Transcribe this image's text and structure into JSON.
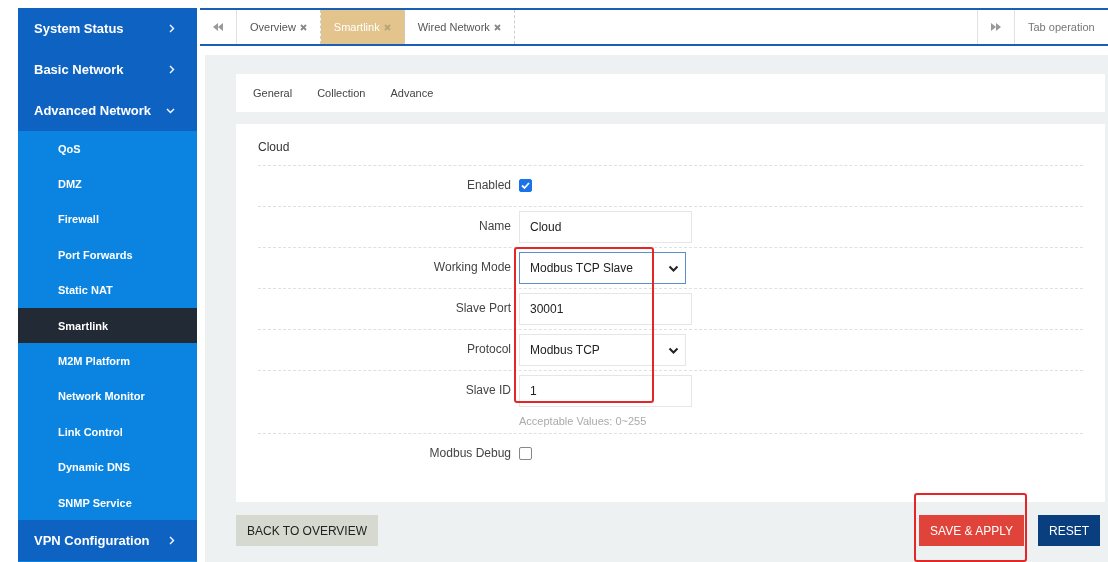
{
  "sidebar": {
    "items": [
      {
        "label": "System Status",
        "expanded": false
      },
      {
        "label": "Basic Network",
        "expanded": false
      },
      {
        "label": "Advanced Network",
        "expanded": true,
        "children": [
          {
            "label": "QoS",
            "selected": false
          },
          {
            "label": "DMZ",
            "selected": false
          },
          {
            "label": "Firewall",
            "selected": false
          },
          {
            "label": "Port Forwards",
            "selected": false
          },
          {
            "label": "Static NAT",
            "selected": false
          },
          {
            "label": "Smartlink",
            "selected": true
          },
          {
            "label": "M2M Platform",
            "selected": false
          },
          {
            "label": "Network Monitor",
            "selected": false
          },
          {
            "label": "Link Control",
            "selected": false
          },
          {
            "label": "Dynamic DNS",
            "selected": false
          },
          {
            "label": "SNMP Service",
            "selected": false
          }
        ]
      },
      {
        "label": "VPN Configuration",
        "expanded": false
      }
    ]
  },
  "tab_bar": {
    "tabs": [
      {
        "label": "Overview",
        "selected": false
      },
      {
        "label": "Smartlink",
        "selected": true
      },
      {
        "label": "Wired Network",
        "selected": false
      }
    ],
    "operation_label": "Tab operation"
  },
  "subtabs": [
    {
      "label": "General",
      "selected": false
    },
    {
      "label": "Collection",
      "selected": false
    },
    {
      "label": "Advance",
      "selected": false
    }
  ],
  "form": {
    "section_title": "Cloud",
    "fields": [
      {
        "kind": "checkbox",
        "label": "Enabled",
        "checked": true,
        "highlighted": false
      },
      {
        "kind": "text",
        "label": "Name",
        "value": "Cloud",
        "highlighted": false
      },
      {
        "kind": "select",
        "label": "Working Mode",
        "value": "Modbus TCP Slave",
        "focused": true,
        "highlighted": true
      },
      {
        "kind": "text",
        "label": "Slave Port",
        "value": "30001",
        "highlighted": true
      },
      {
        "kind": "select",
        "label": "Protocol",
        "value": "Modbus TCP",
        "focused": false,
        "highlighted": true
      },
      {
        "kind": "text",
        "label": "Slave ID",
        "value": "1",
        "help": "Acceptable Values: 0~255",
        "highlighted": true
      },
      {
        "kind": "checkbox",
        "label": "Modbus Debug",
        "checked": false,
        "highlighted": false
      }
    ]
  },
  "buttons": [
    {
      "kind": "back",
      "label": "BACK TO OVERVIEW",
      "highlighted": false
    },
    {
      "kind": "save",
      "label": "SAVE & APPLY",
      "highlighted": true
    },
    {
      "kind": "reset",
      "label": "RESET",
      "highlighted": false
    }
  ]
}
